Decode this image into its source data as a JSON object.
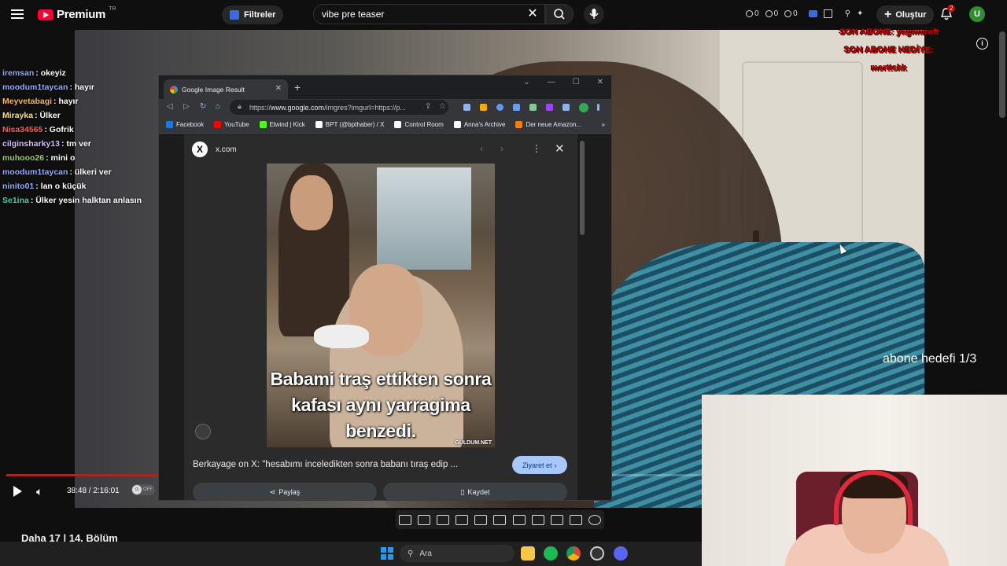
{
  "youtube": {
    "logo_word": "Premium",
    "logo_region": "TR",
    "filters_label": "Filtreler",
    "search_value": "vibe pre teaser",
    "create_label": "Oluştur",
    "notification_count": "2",
    "avatar_initial": "U",
    "ext_stats": [
      "0",
      "0",
      "0"
    ],
    "accent": "#ff0033"
  },
  "stream_overlay": {
    "last_sub_line1": "SON ABONE: yagmuroft",
    "last_sub_line2": "SON ABONE HEDİYE: merttckk",
    "goal_text": "abone hedefi 1/3"
  },
  "chat": [
    {
      "user": "iremsan",
      "msg": ": okeyiz",
      "color": "#8fa9ff"
    },
    {
      "user": "moodum1taycan",
      "msg": ": hayır",
      "color": "#8fa9ff"
    },
    {
      "user": "Meyvetabagi",
      "msg": ": hayır",
      "color": "#ffb347"
    },
    {
      "user": "Mirayka",
      "msg": ": Ülker",
      "color": "#ffe36e"
    },
    {
      "user": "Nisa34565",
      "msg": ": Gofrik",
      "color": "#ff5a5a"
    },
    {
      "user": "cilginsharky13",
      "msg": ": tm ver",
      "color": "#d8b8ff"
    },
    {
      "user": "muhooo26",
      "msg": ": mini o",
      "color": "#9acd5a"
    },
    {
      "user": "moodum1taycan",
      "msg": ": ülkeri ver",
      "color": "#8fa9ff"
    },
    {
      "user": "ninito01",
      "msg": ": lan o küçük",
      "color": "#8fa9ff"
    },
    {
      "user": "Se1ina",
      "msg": ": Ülker yesin halktan anlasın",
      "color": "#41d6a0"
    }
  ],
  "player": {
    "time": "38:48 / 2:16:01",
    "progress": 0.2854,
    "autoplay_state": "OFF",
    "below_title": "Daha 17 | 14. Bölüm"
  },
  "taskbar": {
    "search_placeholder": "Ara"
  },
  "chrome": {
    "tab_title": "Google Image Result",
    "url_prefix": "https://",
    "url_domain": "www.google.com",
    "url_rest": "/imgres?imgurl=https://p...",
    "bookmarks": [
      "Facebook",
      "YouTube",
      "Elwind | Kick",
      "BPT (@bpthaber) / X",
      "Control Room",
      "Anna's Archive",
      "Der neue Amazon..."
    ],
    "bookmark_colors": [
      "#1877f2",
      "#ff0000",
      "#53fc18",
      "#ffffff",
      "#ffffff",
      "#ffffff",
      "#ff7a00"
    ],
    "more_bookmarks": "»"
  },
  "image_panel": {
    "source": "x.com",
    "meme_caption": "Babami traş ettikten sonra kafası aynı yarragima benzedi.",
    "watermark": "GULDUM.NET",
    "result_title": "Berkayage on X: \"hesabımı inceledikten sonra babanı tıraş edip ...",
    "visit_label": "Ziyaret et",
    "share_label": "Paylaş",
    "save_label": "Kaydet"
  }
}
